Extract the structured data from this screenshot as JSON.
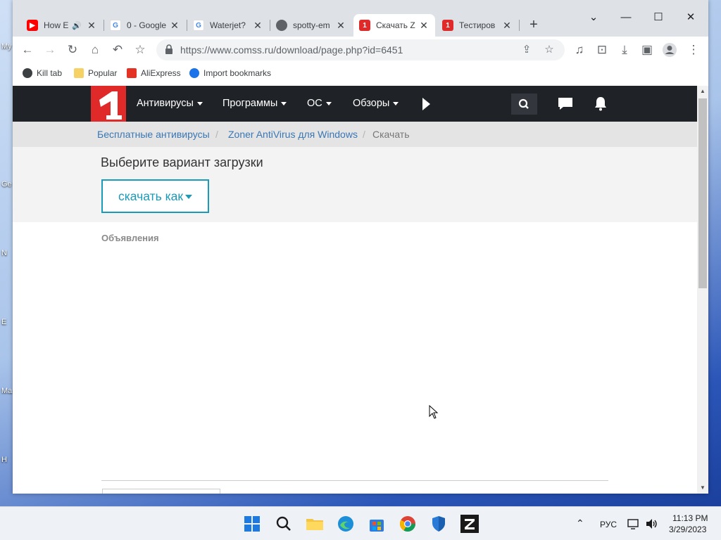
{
  "desktop": {
    "icon_labels": [
      "My",
      "Ge",
      "N",
      "E",
      "Ma",
      "H"
    ]
  },
  "browser": {
    "tabs": [
      {
        "title": "How E",
        "icon": "youtube-icon",
        "icon_color": "#ff0000",
        "audio": true
      },
      {
        "title": "0 - Google",
        "icon": "google-icon",
        "icon_color": "#4285f4"
      },
      {
        "title": "Waterjet?",
        "icon": "google-icon",
        "icon_color": "#4285f4"
      },
      {
        "title": "spotty-em",
        "icon": "globe-icon",
        "icon_color": "#5f6368"
      },
      {
        "title": "Скачать Z",
        "icon": "comss-icon",
        "icon_color": "#e02a2a",
        "active": true
      },
      {
        "title": "Тестиров",
        "icon": "comss-icon",
        "icon_color": "#e02a2a"
      }
    ],
    "omnibox": {
      "url": "https://www.comss.ru/download/page.php?id=6451"
    },
    "bookmarks": [
      {
        "label": "Kill tab",
        "icon": "kill-tab-icon"
      },
      {
        "label": "Popular",
        "icon": "folder-icon",
        "color": "#f6d264"
      },
      {
        "label": "AliExpress",
        "icon": "aliexpress-icon",
        "color": "#e43225"
      },
      {
        "label": "Import bookmarks",
        "icon": "gear-icon",
        "color": "#1a73e8"
      }
    ]
  },
  "page": {
    "nav": {
      "items": [
        "Антивирусы",
        "Программы",
        "ОС",
        "Обзоры"
      ],
      "brand_color": "#e02a2a"
    },
    "breadcrumb": {
      "items": [
        "Бесплатные антивирусы",
        "Zoner AntiVirus для Windows"
      ],
      "current": "Скачать",
      "separator": "/"
    },
    "download": {
      "heading": "Выберите вариант загрузки",
      "button_label": "скачать как",
      "accent": "#1a9bb8"
    },
    "ads_label": "Объявления"
  },
  "taskbar": {
    "apps": [
      "start-icon",
      "search-icon",
      "file-explorer-icon",
      "edge-icon",
      "store-icon",
      "chrome-icon",
      "defender-icon",
      "zoner-icon"
    ],
    "language": "РУС",
    "time": "11:13 PM",
    "date": "3/29/2023"
  }
}
